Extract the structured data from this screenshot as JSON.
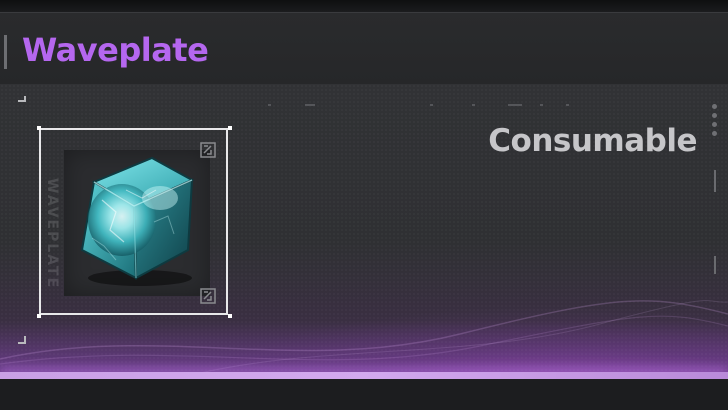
{
  "item": {
    "name": "Waveplate",
    "category": "Consumable",
    "vertical_label": "WAVEPLATE",
    "icon": "waveplate-cube-icon"
  },
  "colors": {
    "title": "#b567ef",
    "category": "#c6c6c9",
    "accent_glow": "#d3a9ef",
    "cube": "#5fd6dc"
  }
}
